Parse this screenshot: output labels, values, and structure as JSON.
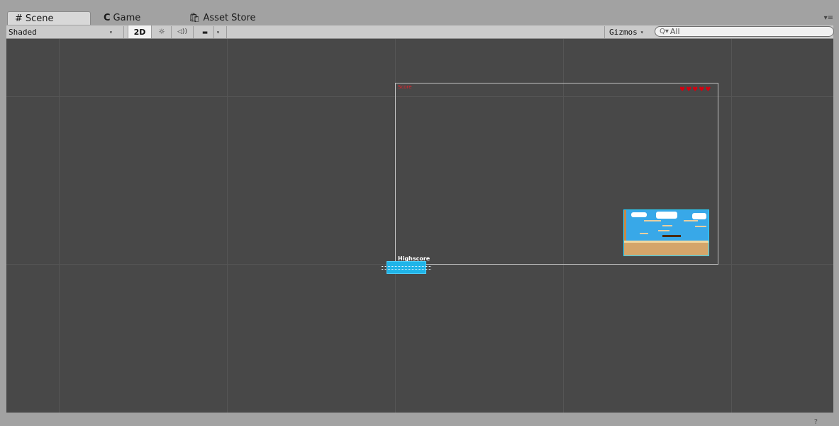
{
  "tabs": [
    {
      "icon": "#",
      "label": "Scene"
    },
    {
      "icon": "C",
      "label": "Game"
    },
    {
      "icon": "🛍",
      "label": "Asset Store"
    }
  ],
  "tab_menu": "▾≡",
  "toolbar": {
    "shading_mode": "Shaded",
    "dropdown_arrow": "▾",
    "mode_2d": "2D",
    "lighting_icon": "☼",
    "audio_icon": "◁))",
    "effects_icon": "▬",
    "gizmos_label": "Gizmos",
    "search_icon": "Q▾",
    "search_placeholder": "All"
  },
  "scene": {
    "score_label": "Score",
    "highscore_label": "Highscore",
    "hearts": [
      "♥",
      "♥",
      "♥",
      "♥",
      "♥"
    ]
  },
  "status": {
    "text": "?"
  }
}
